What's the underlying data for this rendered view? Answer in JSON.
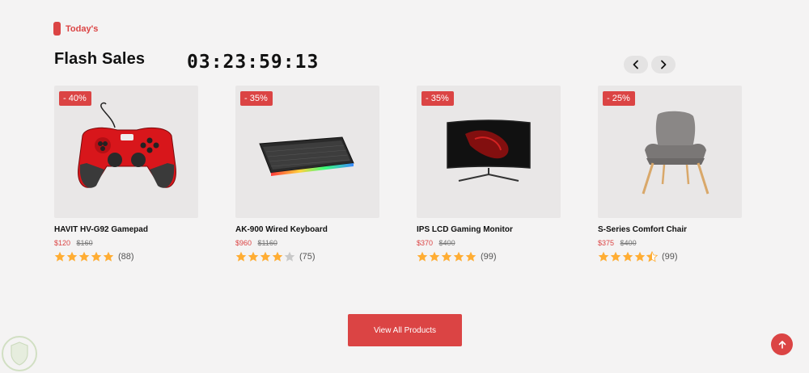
{
  "section": {
    "tag": "Today's",
    "title": "Flash Sales",
    "countdown": "03:23:59:13"
  },
  "nav": {
    "prev_icon": "chevron-left-icon",
    "next_icon": "chevron-right-icon"
  },
  "products": [
    {
      "discount": "- 40%",
      "name": "HAVIT HV-G92 Gamepad",
      "price": "$120",
      "old_price": "$160",
      "rating": 5,
      "reviews": "(88)",
      "image_icon": "gamepad-icon"
    },
    {
      "discount": "- 35%",
      "name": "AK-900 Wired Keyboard",
      "price": "$960",
      "old_price": "$1160",
      "rating": 4,
      "reviews": "(75)",
      "image_icon": "keyboard-icon"
    },
    {
      "discount": "- 35%",
      "name": "IPS LCD Gaming Monitor",
      "price": "$370",
      "old_price": "$400",
      "rating": 5,
      "reviews": "(99)",
      "image_icon": "monitor-icon"
    },
    {
      "discount": "- 25%",
      "name": "S-Series Comfort Chair",
      "price": "$375",
      "old_price": "$400",
      "rating": 4.5,
      "reviews": "(99)",
      "image_icon": "chair-icon"
    }
  ],
  "view_all_label": "View All Products",
  "scroll_top_icon": "arrow-up-icon",
  "colors": {
    "accent": "#db4444",
    "star": "#ffad33",
    "star_empty": "#c9c9c9",
    "background": "#f4f3f3"
  }
}
